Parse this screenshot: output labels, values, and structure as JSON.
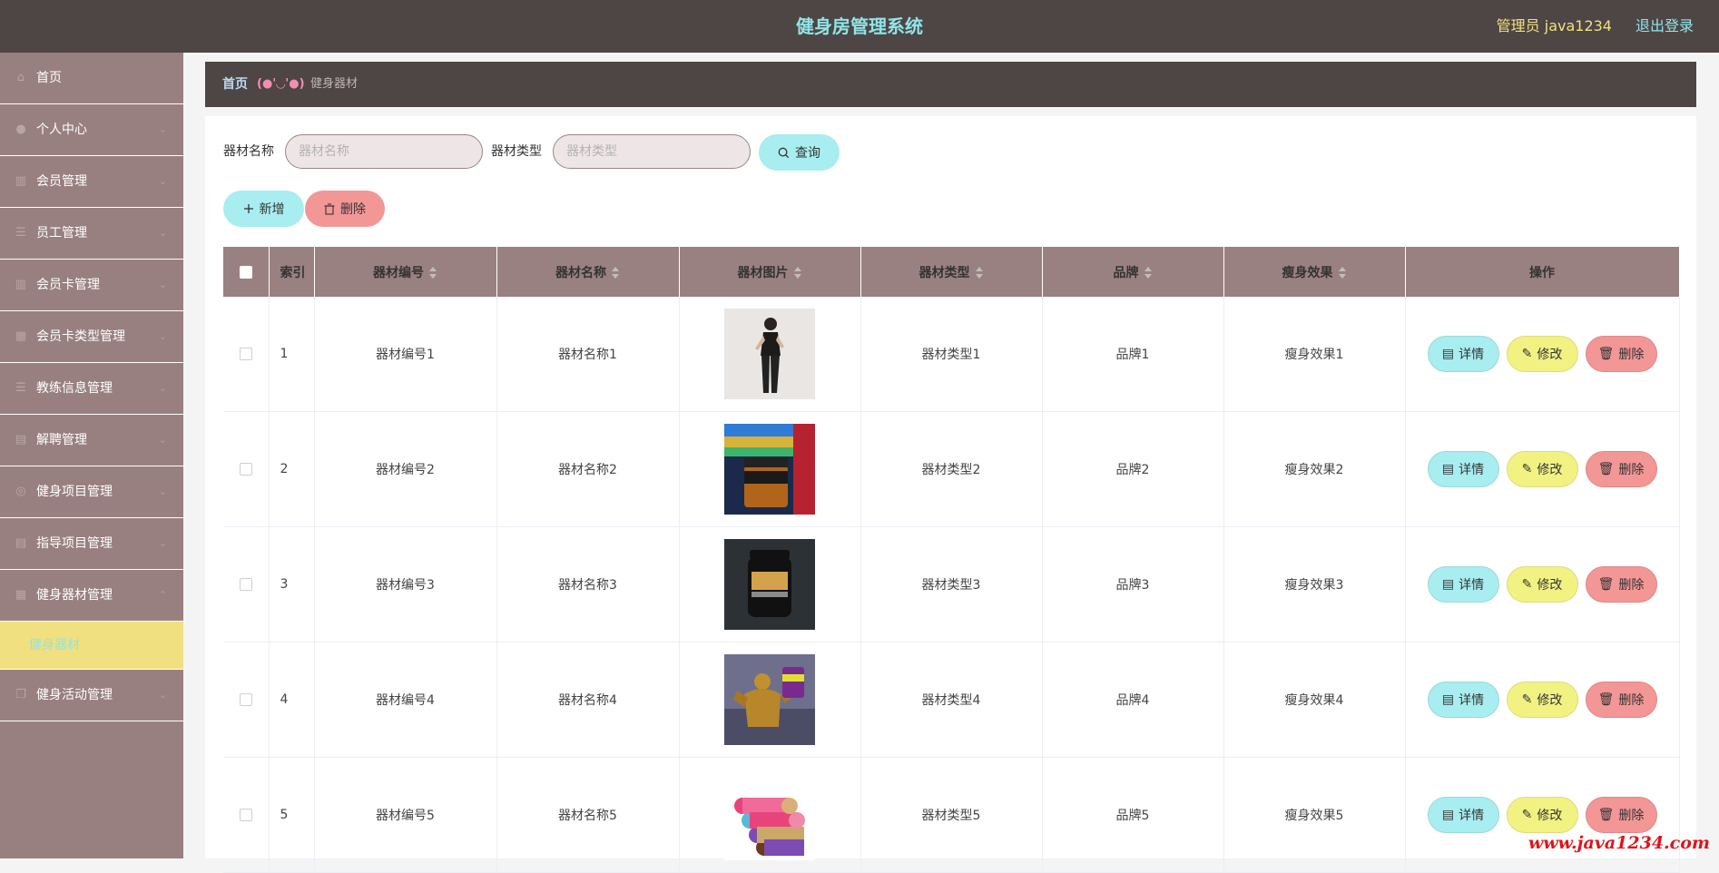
{
  "header": {
    "title": "健身房管理系统",
    "user": "管理员 java1234",
    "logout": "退出登录"
  },
  "sidebar": {
    "items": [
      {
        "label": "首页",
        "icon": "home-icon"
      },
      {
        "label": "个人中心",
        "icon": "user-icon"
      },
      {
        "label": "会员管理",
        "icon": "chart-icon"
      },
      {
        "label": "员工管理",
        "icon": "list-icon"
      },
      {
        "label": "会员卡管理",
        "icon": "chart-icon"
      },
      {
        "label": "会员卡类型管理",
        "icon": "building-icon"
      },
      {
        "label": "教练信息管理",
        "icon": "list-icon"
      },
      {
        "label": "解聘管理",
        "icon": "briefcase-icon"
      },
      {
        "label": "健身项目管理",
        "icon": "circle-icon"
      },
      {
        "label": "指导项目管理",
        "icon": "doc-icon"
      },
      {
        "label": "健身器材管理",
        "icon": "calendar-icon"
      }
    ],
    "active_sub": "健身器材",
    "last_item": {
      "label": "健身活动管理",
      "icon": "copy-icon"
    }
  },
  "breadcrumb": {
    "home": "首页",
    "separator": "(●'◡'●)",
    "current": "健身器材"
  },
  "search": {
    "name_label": "器材名称",
    "name_placeholder": "器材名称",
    "type_label": "器材类型",
    "type_placeholder": "器材类型",
    "query_button": "查询"
  },
  "actions": {
    "add": "新增",
    "delete": "删除"
  },
  "table": {
    "headers": {
      "index": "索引",
      "code": "器材编号",
      "name": "器材名称",
      "image": "器材图片",
      "type": "器材类型",
      "brand": "品牌",
      "effect": "瘦身效果",
      "ops": "操作"
    },
    "rows": [
      {
        "index": "1",
        "code": "器材编号1",
        "name": "器材名称1",
        "type": "器材类型1",
        "brand": "品牌1",
        "effect": "瘦身效果1",
        "image": "fitness-woman-photo"
      },
      {
        "index": "2",
        "code": "器材编号2",
        "name": "器材名称2",
        "type": "器材类型2",
        "brand": "品牌2",
        "effect": "瘦身效果2",
        "image": "supplement-jar-photo"
      },
      {
        "index": "3",
        "code": "器材编号3",
        "name": "器材名称3",
        "type": "器材类型3",
        "brand": "品牌3",
        "effect": "瘦身效果3",
        "image": "protein-tub-photo"
      },
      {
        "index": "4",
        "code": "器材编号4",
        "name": "器材名称4",
        "type": "器材类型4",
        "brand": "品牌4",
        "effect": "瘦身效果4",
        "image": "bodybuilder-statue-photo"
      },
      {
        "index": "5",
        "code": "器材编号5",
        "name": "器材名称5",
        "type": "器材类型5",
        "brand": "品牌5",
        "effect": "瘦身效果5",
        "image": "yoga-mats-photo"
      }
    ],
    "row_buttons": {
      "detail": "详情",
      "edit": "修改",
      "delete": "删除"
    }
  },
  "watermark": "www.java1234.com",
  "colors": {
    "header": "#4e4545",
    "sidebar": "#998080",
    "accent_cyan": "#a8edef",
    "accent_red": "#f39696",
    "accent_yellow": "#f2f283",
    "active_sub": "#f0e080"
  }
}
